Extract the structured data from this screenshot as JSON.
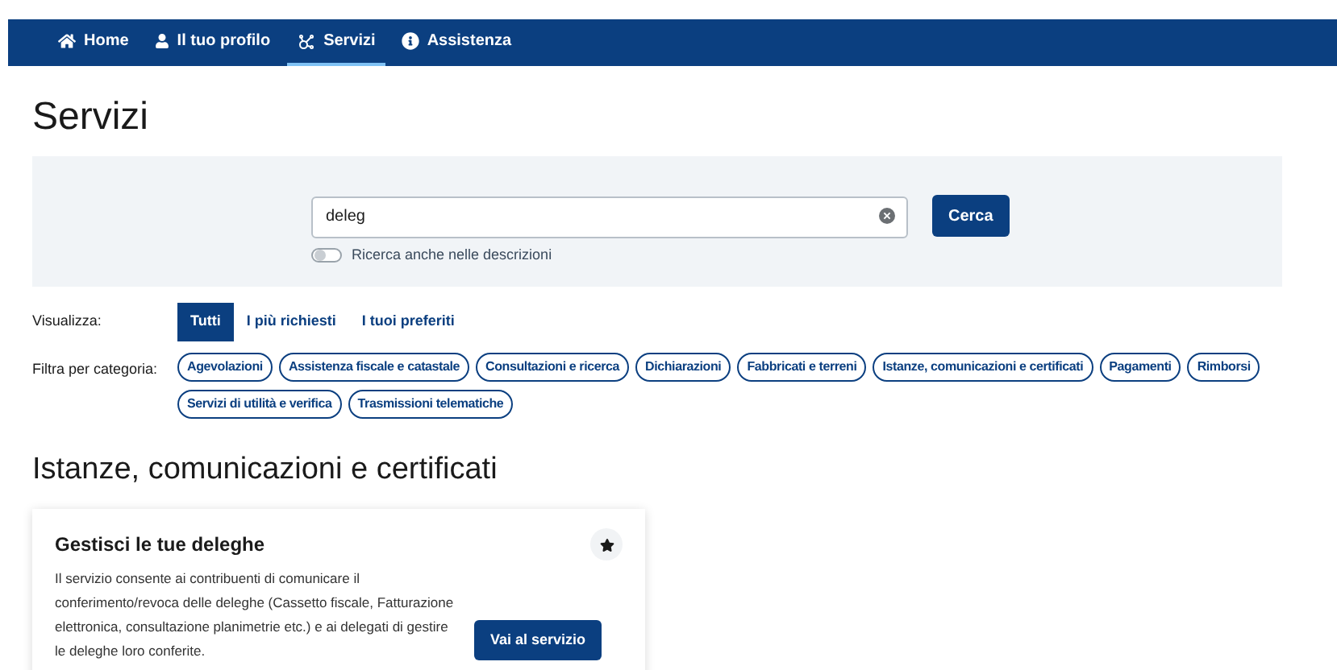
{
  "nav": [
    {
      "label": "Home",
      "selected": false
    },
    {
      "label": "Il tuo profilo",
      "selected": false
    },
    {
      "label": "Servizi",
      "selected": true
    },
    {
      "label": "Assistenza",
      "selected": false
    }
  ],
  "title": "Servizi",
  "search": {
    "value": "deleg",
    "button": "Cerca",
    "toggle": {
      "label": "Ricerca anche nelle descrizioni",
      "on": false
    }
  },
  "view": {
    "label": "Visualizza:",
    "tabs": [
      {
        "label": "Tutti",
        "selected": true
      },
      {
        "label": "I più richiesti",
        "selected": false
      },
      {
        "label": "I tuoi preferiti",
        "selected": false
      }
    ]
  },
  "filter": {
    "label": "Filtra per categoria:",
    "chips": [
      "Agevolazioni",
      "Assistenza fiscale e catastale",
      "Consultazioni e ricerca",
      "Dichiarazioni",
      "Fabbricati e terreni",
      "Istanze, comunicazioni e certificati",
      "Pagamenti",
      "Rimborsi",
      "Servizi di utilità e verifica",
      "Trasmissioni telematiche"
    ]
  },
  "section": "Istanze, comunicazioni e certificati",
  "card": {
    "title": "Gestisci le tue deleghe",
    "text": "Il servizio consente ai contribuenti di comunicare il conferimento/revoca delle deleghe (Cassetto fiscale, Fatturazione elettronica, consultazione planimetrie etc.) e ai delegati di gestire le deleghe loro conferite.",
    "button": "Vai al servizio"
  }
}
